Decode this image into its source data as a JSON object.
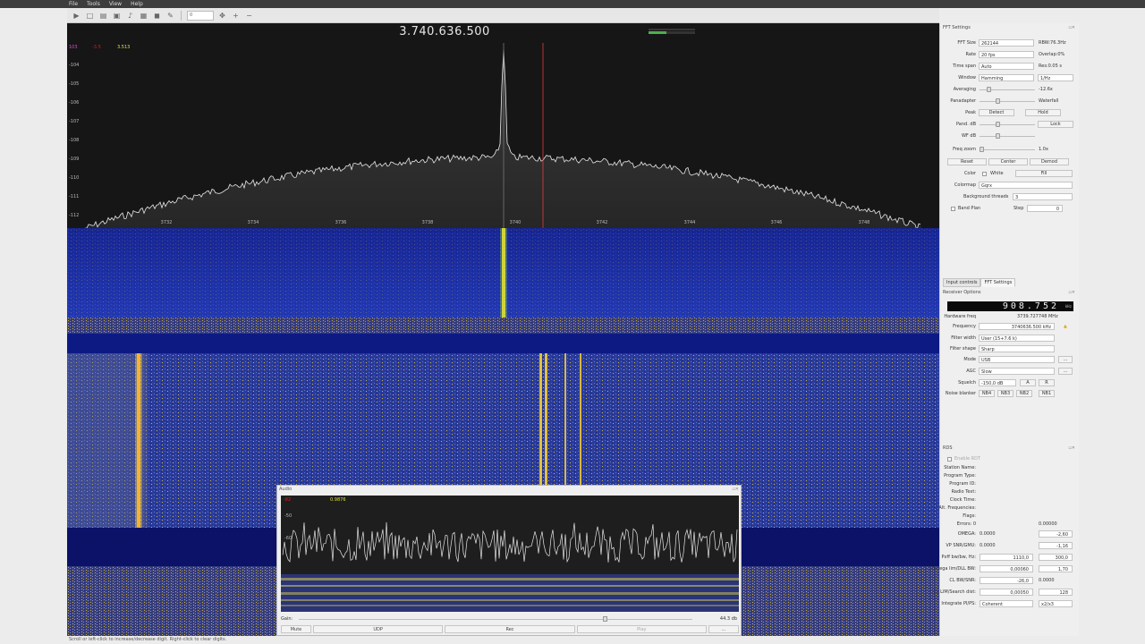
{
  "menu": [
    "File",
    "Tools",
    "View",
    "Help"
  ],
  "toolbar": {
    "icons": [
      "start-icon",
      "new-icon",
      "open-icon",
      "save-icon",
      "mic-icon",
      "device-icon",
      "record-icon",
      "settings-icon",
      "zoom-icon",
      "zoom-fit-icon",
      "zoom-out-icon"
    ],
    "zoom_value": "0"
  },
  "spectrum": {
    "frequency": "3.740.636.500",
    "readout": {
      "a": "103",
      "b": "3.513"
    },
    "db_labels": [
      "-104",
      "-105",
      "-106",
      "-107",
      "-108",
      "-109",
      "-110",
      "-111",
      "-112"
    ],
    "freq_labels": [
      "3732",
      "3734",
      "3736",
      "3738",
      "3740",
      "3742",
      "3744",
      "3746",
      "3748"
    ]
  },
  "status_bar": "Scroll or left-click to increase/decrease digit. Right-click to clear digits.",
  "fft_settings": {
    "title": "FFT Settings",
    "fft_size": "262144",
    "rbw": "RBW:76.3Hz",
    "rate": "20 fps",
    "overlap": "Overlap:0%",
    "time_span": "Auto",
    "res": "Res:0.05 s",
    "window": "Hamming",
    "window_unit": "1/Hz",
    "averaging_label": "Averaging",
    "averaging_value": "-12.6x",
    "panadapter_label": "Panadapter",
    "waterfall_label": "Waterfall",
    "peak_label": "Peak",
    "detect": "Detect",
    "hold": "Hold",
    "pand_db": "Pand. dB",
    "lock": "Lock",
    "wf_db": "WF dB",
    "freq_zoom": "Freq zoom",
    "freq_zoom_value": "1.0x",
    "reset": "Reset",
    "center": "Center",
    "demod": "Demod",
    "color_label": "Color",
    "white": "White",
    "fill": "Fill",
    "colormap_label": "Colormap",
    "colormap": "Gqrx",
    "bg_threads_label": "Background threads",
    "bg_threads": "3",
    "band_plan": "Band Plan",
    "step_label": "Step",
    "step": "0",
    "rate_label": "Rate",
    "time_span_label": "Time span",
    "window_label": "Window",
    "fft_size_label": "FFT Size"
  },
  "tabs": [
    "Input controls",
    "FFT Settings"
  ],
  "receiver": {
    "title": "Receiver Options",
    "lcd": "908.752",
    "lcd_unit": "kHz",
    "hw_freq_label": "Hardware freq",
    "hw_freq": "3739.727748 MHz",
    "frequency_label": "Frequency",
    "frequency": "3740636.500 kHz",
    "filter_width_label": "Filter width",
    "filter_width": "User (15+7.6 k)",
    "filter_shape_label": "Filter shape",
    "filter_shape": "Sharp",
    "mode_label": "Mode",
    "mode": "USB",
    "agc_label": "AGC",
    "agc": "Slow",
    "squelch_label": "Squelch",
    "squelch": "-150,0 dB",
    "squelch_a": "A",
    "squelch_r": "R",
    "nb_label": "Noise blanker",
    "nb": [
      "NB4",
      "NB3",
      "NB2",
      "NB1"
    ]
  },
  "rds": {
    "title": "RDS",
    "enable": "Enable RDT",
    "fields": [
      "Station Name:",
      "Program Type:",
      "Program ID:",
      "Radio Text:",
      "Clock Time:",
      "Alt. Frequencies:",
      "Flags:"
    ],
    "errors_label": "Errors: 0",
    "errors_value": "0.00000",
    "rows": [
      {
        "label": "OMEGA:",
        "value": "0.0000",
        "input": "-2,60"
      },
      {
        "label": "VP SNR/GMU:",
        "value": "0.0000",
        "input": "-1,16"
      },
      {
        "label": "Pxff bw/bw, Hz:",
        "value": "1110,0",
        "input": "300,0"
      },
      {
        "label": "Omega lim/DLL BW:",
        "value": "0,00060",
        "input": "1,70"
      },
      {
        "label": "CL BW/SNR:",
        "value": "-26,0",
        "input": "0.0000"
      },
      {
        "label": "CL LIM/Search dist:",
        "value": "0,00050",
        "input": "128"
      },
      {
        "label": "Integrate PI/PS:",
        "value": "Coherent",
        "input": "x2/x3"
      }
    ]
  },
  "audio": {
    "title": "Audio",
    "readout_a": "0.9876",
    "db_labels": [
      "-50",
      "-60"
    ],
    "gain_label": "Gain:",
    "gain_value": "44.3 db",
    "buttons": [
      "Mute",
      "UDP",
      "Rec",
      "Play",
      "..."
    ]
  },
  "colors": {
    "spectrum_bg": "#161616",
    "waterfall_blue": "#1e3ea8",
    "signal_yellow": "#f1d53a",
    "trace": "#e8e8e8",
    "marker_red": "#e04040"
  }
}
